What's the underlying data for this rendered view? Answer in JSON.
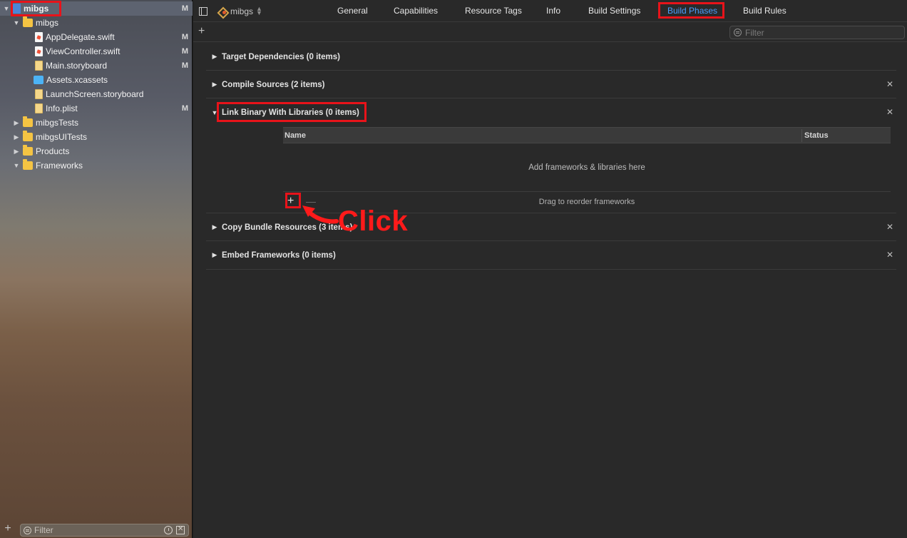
{
  "navigator": {
    "project": {
      "name": "mibgs",
      "badge": "M"
    },
    "items": [
      {
        "label": "mibgs",
        "badge": "",
        "kind": "folder"
      },
      {
        "label": "AppDelegate.swift",
        "badge": "M",
        "kind": "swift"
      },
      {
        "label": "ViewController.swift",
        "badge": "M",
        "kind": "swift"
      },
      {
        "label": "Main.storyboard",
        "badge": "M",
        "kind": "storyboard"
      },
      {
        "label": "Assets.xcassets",
        "badge": "",
        "kind": "assets"
      },
      {
        "label": "LaunchScreen.storyboard",
        "badge": "",
        "kind": "storyboard"
      },
      {
        "label": "Info.plist",
        "badge": "M",
        "kind": "plist"
      },
      {
        "label": "mibgsTests",
        "badge": "",
        "kind": "folder"
      },
      {
        "label": "mibgsUITests",
        "badge": "",
        "kind": "folder"
      },
      {
        "label": "Products",
        "badge": "",
        "kind": "folder"
      },
      {
        "label": "Frameworks",
        "badge": "",
        "kind": "folder"
      }
    ],
    "filter_placeholder": "Filter"
  },
  "editor": {
    "target_name": "mibgs",
    "tabs": [
      "General",
      "Capabilities",
      "Resource Tags",
      "Info",
      "Build Settings",
      "Build Phases",
      "Build Rules"
    ],
    "active_tab": "Build Phases",
    "filter_placeholder": "Filter",
    "phases": [
      {
        "title": "Target Dependencies (0 items)",
        "expanded": false,
        "closable": false
      },
      {
        "title": "Compile Sources (2 items)",
        "expanded": false,
        "closable": true
      },
      {
        "title": "Link Binary With Libraries (0 items)",
        "expanded": true,
        "closable": true
      },
      {
        "title": "Copy Bundle Resources (3 items)",
        "expanded": false,
        "closable": true
      },
      {
        "title": "Embed Frameworks (0 items)",
        "expanded": false,
        "closable": true
      }
    ],
    "library_table": {
      "col_name": "Name",
      "col_status": "Status",
      "empty_text": "Add frameworks & libraries here",
      "reorder_text": "Drag to reorder frameworks",
      "add_symbol": "+",
      "remove_symbol": "—"
    }
  },
  "annotation": {
    "text": "Click",
    "color": "#ff1a1a"
  },
  "icons": {
    "expanded": "▼",
    "collapsed": "▶",
    "close": "✕",
    "add": "+"
  }
}
